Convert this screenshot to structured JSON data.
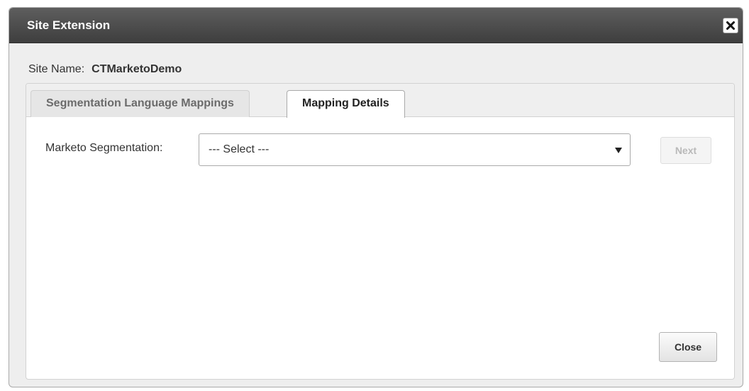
{
  "dialog": {
    "title": "Site Extension"
  },
  "site": {
    "label": "Site Name:",
    "value": "CTMarketoDemo"
  },
  "tabs": [
    {
      "label": "Segmentation Language Mappings",
      "active": false
    },
    {
      "label": "Mapping Details",
      "active": true
    }
  ],
  "mapping": {
    "segmentation_label": "Marketo Segmentation:",
    "segmentation_selected": "--- Select ---"
  },
  "buttons": {
    "next_label": "Next",
    "close_label": "Close"
  },
  "icons": {
    "close": "close-icon",
    "dropdown": "caret-down-icon"
  },
  "colors": {
    "titlebar": "#4a4a4a",
    "disabled_text": "#b9b9b9"
  }
}
